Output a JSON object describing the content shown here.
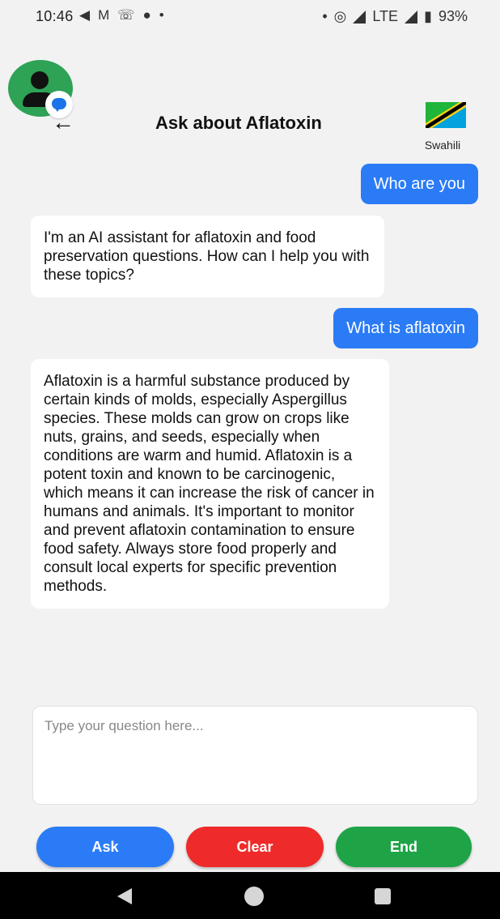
{
  "status_bar": {
    "time": "10:46",
    "network": "LTE",
    "battery": "93%",
    "left_icons": [
      "telegram-icon",
      "gmail-icon",
      "voicemail-icon",
      "location-pin-icon",
      "dot"
    ],
    "right_icons": [
      "dot",
      "hotspot-icon",
      "signal-icon",
      "signal-icon",
      "battery-icon"
    ]
  },
  "header": {
    "title": "Ask about Aflatoxin",
    "language_label": "Swahili",
    "flag": "tanzania-flag-icon"
  },
  "messages": [
    {
      "role": "user",
      "text": "Who are you"
    },
    {
      "role": "assistant",
      "text": "I'm an AI assistant for aflatoxin and food preservation questions. How can I help you with these topics?"
    },
    {
      "role": "user",
      "text": "What is aflatoxin"
    },
    {
      "role": "assistant",
      "text": "Aflatoxin is a harmful substance produced by certain kinds of molds, especially Aspergillus species. These molds can grow on crops like nuts, grains, and seeds, especially when conditions are warm and humid. Aflatoxin is a potent toxin and known to be carcinogenic, which means it can increase the risk of cancer in humans and animals. It's important to monitor and prevent aflatoxin contamination to ensure food safety. Always store food properly and consult local experts for specific prevention methods."
    }
  ],
  "input": {
    "placeholder": "Type your question here...",
    "value": ""
  },
  "buttons": {
    "ask": "Ask",
    "clear": "Clear",
    "end": "End"
  },
  "colors": {
    "user_bubble": "#2b7bf6",
    "ask": "#2b7bf6",
    "clear": "#ee2a2a",
    "end": "#1fa347",
    "avatar": "#2ea255"
  }
}
